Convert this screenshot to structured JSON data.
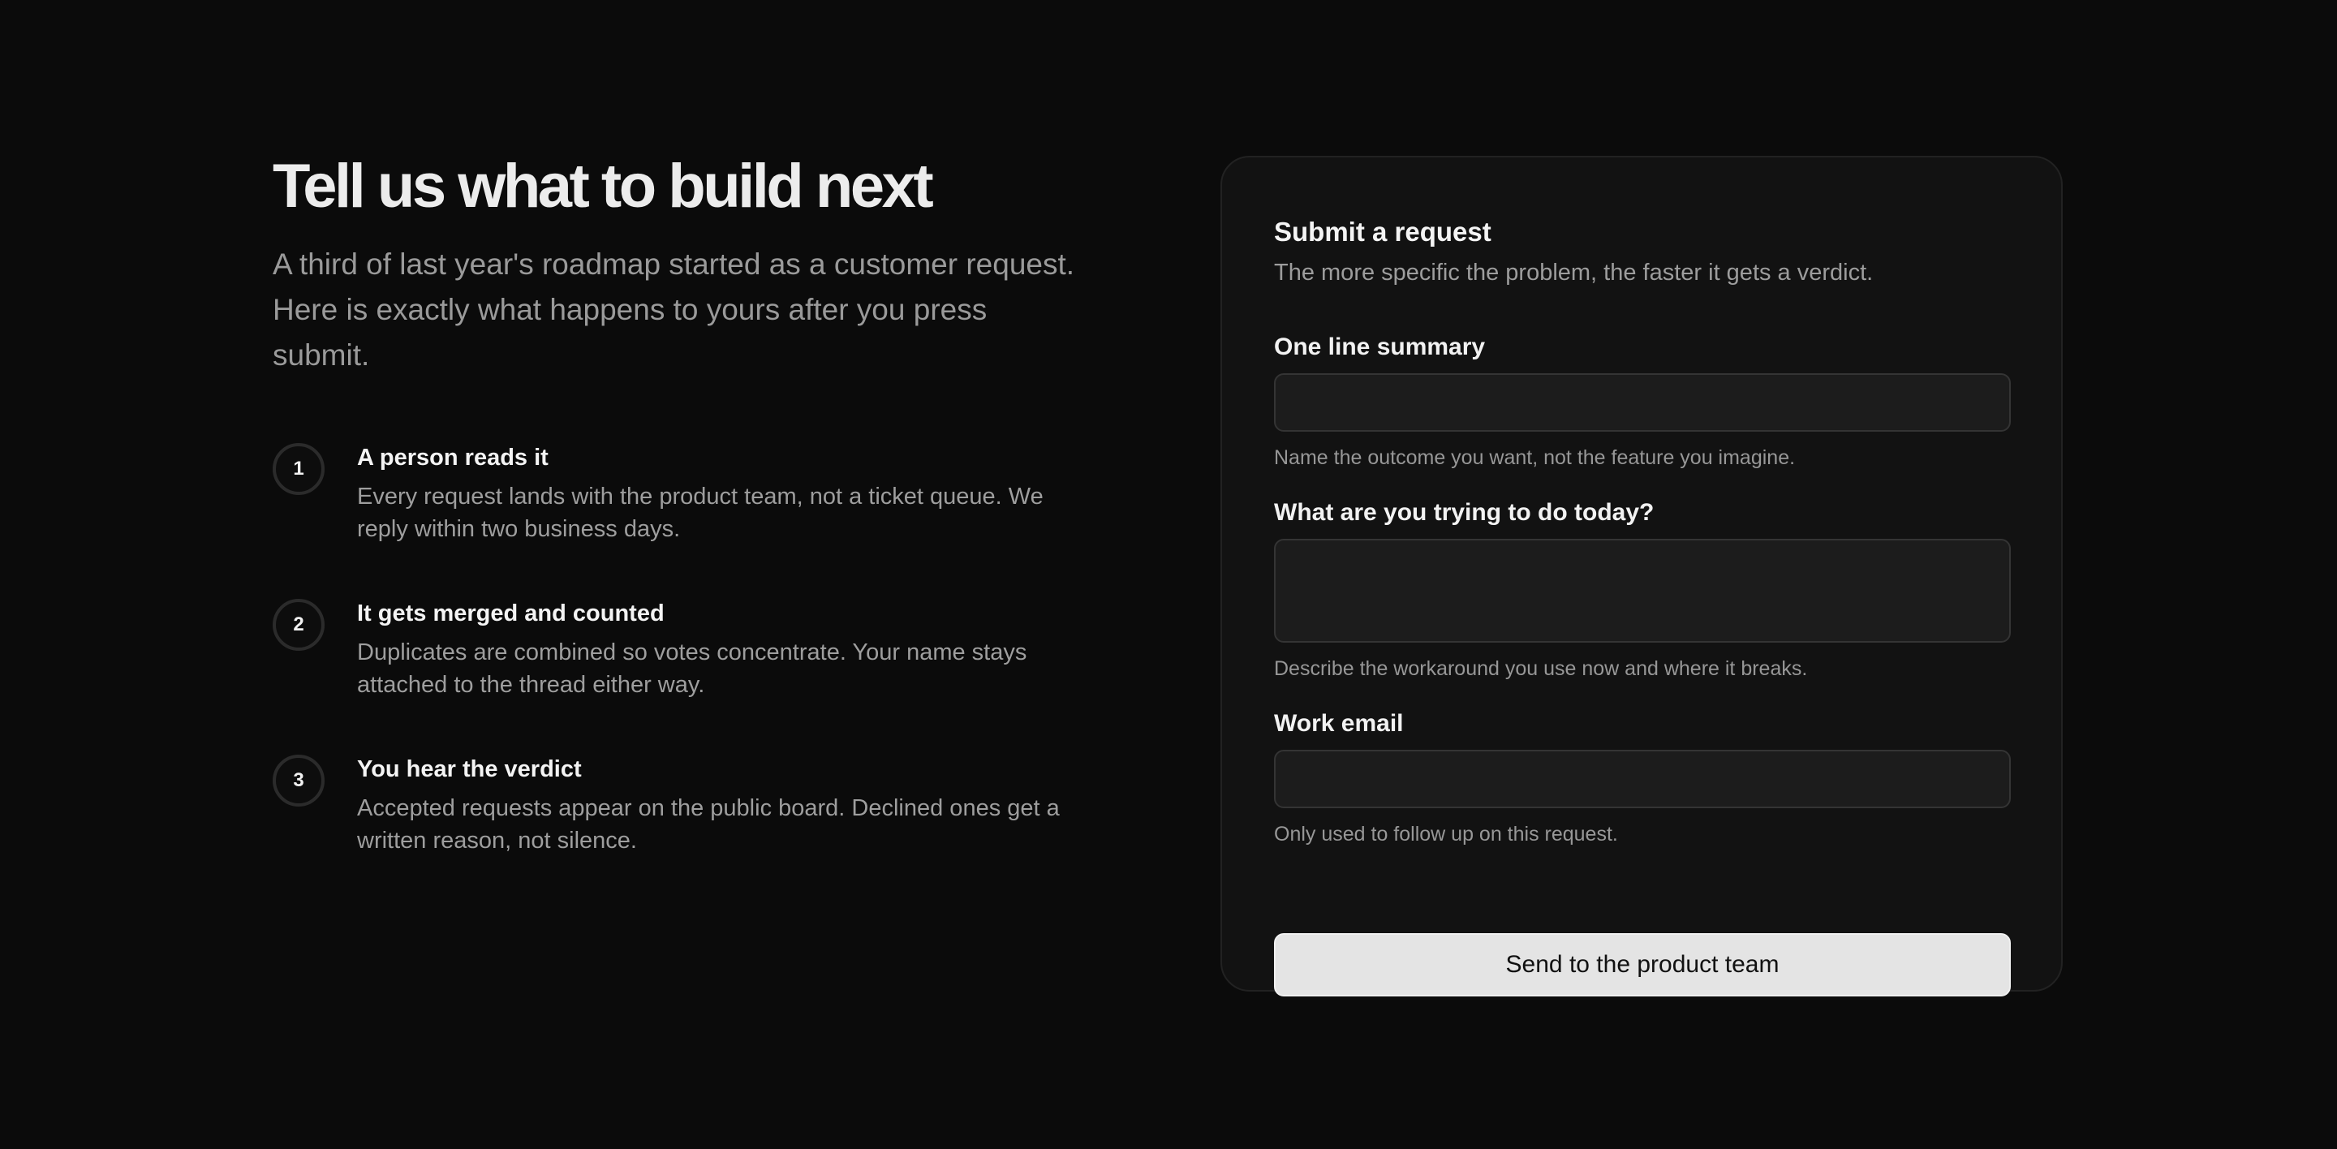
{
  "hero": {
    "title": "Tell us what to build next",
    "intro": "A third of last year's roadmap started as a customer request. Here is exactly what happens to yours after you press submit."
  },
  "steps": [
    {
      "number": "1",
      "title": "A person reads it",
      "description": "Every request lands with the product team, not a ticket queue. We reply within two business days."
    },
    {
      "number": "2",
      "title": "It gets merged and counted",
      "description": "Duplicates are combined so votes concentrate. Your name stays attached to the thread either way."
    },
    {
      "number": "3",
      "title": "You hear the verdict",
      "description": "Accepted requests appear on the public board. Declined ones get a written reason, not silence."
    }
  ],
  "form": {
    "title": "Submit a request",
    "subtitle": "The more specific the problem, the faster it gets a verdict.",
    "fields": {
      "summary": {
        "label": "One line summary",
        "value": "",
        "help": "Name the outcome you want, not the feature you imagine."
      },
      "today": {
        "label": "What are you trying to do today?",
        "value": "",
        "help": "Describe the workaround you use now and where it breaks."
      },
      "email": {
        "label": "Work email",
        "value": "",
        "help": "Only used to follow up on this request."
      }
    },
    "submit_label": "Send to the product team"
  },
  "colors": {
    "background": "#0b0b0b",
    "card": "#121212",
    "input": "#1c1c1c",
    "button": "#e4e4e4",
    "muted_text": "#9d9d9d"
  }
}
